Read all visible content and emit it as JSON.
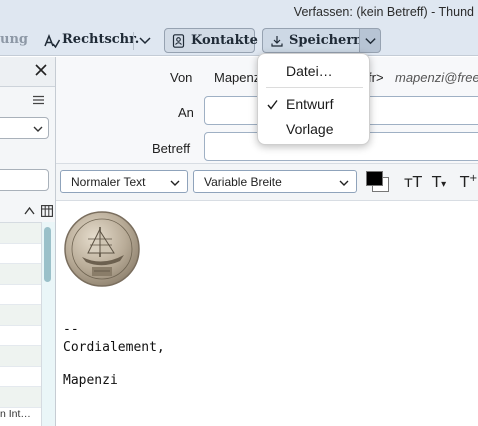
{
  "window": {
    "title": "Verfassen: (kein Betreff) - Thund"
  },
  "toolbar": {
    "faded_label": "ung",
    "spelling_label": "Rechtschr.",
    "contacts_label": "Kontakte",
    "save_label": "Speichern"
  },
  "save_menu": {
    "items": [
      {
        "label": "Datei…",
        "checked": false
      },
      {
        "label": "Entwurf",
        "checked": true
      },
      {
        "label": "Vorlage",
        "checked": false
      }
    ],
    "check_glyph": "✓"
  },
  "headers": {
    "from_label": "Von",
    "from_name": "Mapenz",
    "from_tail": "fr>",
    "from_email": "mapenzi@free",
    "to_label": "An",
    "to_value": "",
    "subject_label": "Betreff",
    "subject_value": ""
  },
  "format_bar": {
    "paragraph_format": "Normaler Text",
    "font_family": "Variable Breite",
    "text_color": "#000000",
    "background_color": "#ffffff"
  },
  "left_pane": {
    "row_text": "n Int…"
  },
  "body": {
    "signature_separator": "--",
    "signature_line_1": "Cordialement,",
    "signature_line_2": "Mapenzi"
  },
  "icons": {
    "spelling": "spellcheck-icon",
    "contacts": "address-book-icon",
    "save": "download-icon",
    "close": "close-icon"
  }
}
